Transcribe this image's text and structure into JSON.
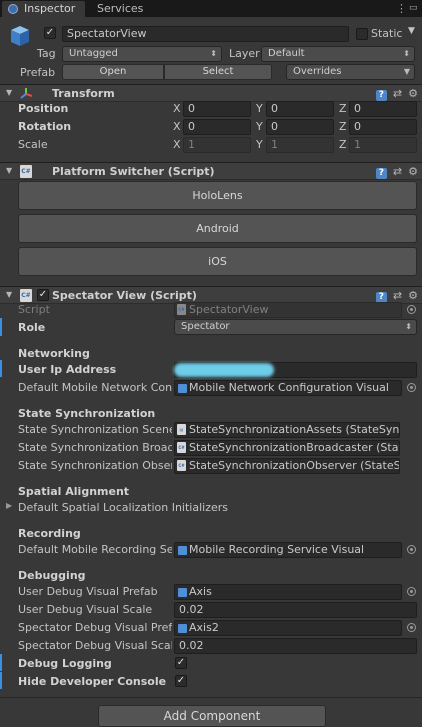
{
  "tabs": {
    "inspector": "Inspector",
    "services": "Services",
    "menu": "⋮"
  },
  "gameobject": {
    "name": "SpectatorView",
    "active": true,
    "static_label": "Static",
    "static": false,
    "tag_label": "Tag",
    "tag": "Untagged",
    "layer_label": "Layer",
    "layer": "Default",
    "prefab_label": "Prefab",
    "prefab_open": "Open",
    "prefab_select": "Select",
    "prefab_overrides": "Overrides"
  },
  "transform": {
    "title": "Transform",
    "position_label": "Position",
    "rotation_label": "Rotation",
    "scale_label": "Scale",
    "axis_x": "X",
    "axis_y": "Y",
    "axis_z": "Z",
    "position": {
      "x": "0",
      "y": "0",
      "z": "0"
    },
    "rotation": {
      "x": "0",
      "y": "0",
      "z": "0"
    },
    "scale": {
      "x": "1",
      "y": "1",
      "z": "1"
    }
  },
  "platform_switcher": {
    "title": "Platform Switcher (Script)",
    "buttons": [
      "HoloLens",
      "Android",
      "iOS"
    ]
  },
  "spectator_view": {
    "title": "Spectator View (Script)",
    "enabled": true,
    "script_label": "Script",
    "script_value": "SpectatorView",
    "role_label": "Role",
    "role_value": "Spectator",
    "networking_header": "Networking",
    "user_ip_label": "User Ip Address",
    "user_ip_value": "",
    "mobile_network_label": "Default Mobile Network Confi",
    "mobile_network_value": "Mobile Network Configuration Visual",
    "state_sync_header": "State Synchronization",
    "state_scene_label": "State Synchronization Scene M",
    "state_scene_value": "StateSynchronizationAssets (StateSynch",
    "state_broadcast_label": "State Synchronization Broadc",
    "state_broadcast_value": "StateSynchronizationBroadcaster (State",
    "state_observer_label": "State Synchronization Observ",
    "state_observer_value": "StateSynchronizationObserver (StateSy",
    "spatial_header": "Spatial Alignment",
    "spatial_initializers_label": "Default Spatial Localization Initializers",
    "recording_header": "Recording",
    "recording_label": "Default Mobile Recording Serv",
    "recording_value": "Mobile Recording Service Visual",
    "debugging_header": "Debugging",
    "user_debug_prefab_label": "User Debug Visual Prefab",
    "user_debug_prefab_value": "Axis",
    "user_debug_scale_label": "User Debug Visual Scale",
    "user_debug_scale_value": "0.02",
    "spectator_debug_prefab_label": "Spectator Debug Visual Prefab",
    "spectator_debug_prefab_value": "Axis2",
    "spectator_debug_scale_label": "Spectator Debug Visual Scale",
    "spectator_debug_scale_value": "0.02",
    "debug_logging_label": "Debug Logging",
    "debug_logging": true,
    "hide_console_label": "Hide Developer Console",
    "hide_console": true
  },
  "add_component": "Add Component",
  "colors": {
    "accent": "#3c8fe6",
    "panel": "#383838",
    "field": "#2a2a2a"
  }
}
